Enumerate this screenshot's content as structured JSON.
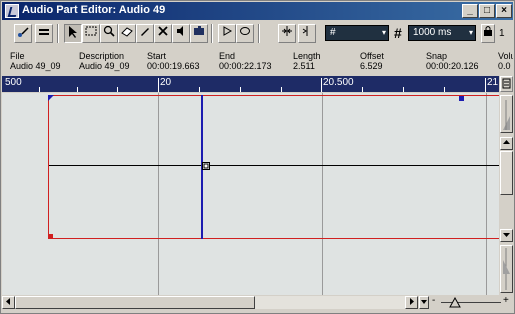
{
  "window": {
    "title": "Audio Part Editor: Audio 49",
    "minimize_glyph": "_",
    "maximize_glyph": "□",
    "close_glyph": "×"
  },
  "toolbar": {
    "quantize_value": "#",
    "grid_value": "1000 ms",
    "snap_count": "1",
    "arrow_glyph": "▾"
  },
  "info": {
    "fields": [
      {
        "label": "File",
        "value": "Audio 49_09"
      },
      {
        "label": "Description",
        "value": "Audio 49_09"
      },
      {
        "label": "Start",
        "value": "00:00:19.663"
      },
      {
        "label": "End",
        "value": "00:00:22.173"
      },
      {
        "label": "Length",
        "value": "2.511"
      },
      {
        "label": "Offset",
        "value": "6.529"
      },
      {
        "label": "Snap",
        "value": "00:00:20.126"
      },
      {
        "label": "Volu",
        "value": "0.0"
      }
    ]
  },
  "ruler": {
    "labels": [
      "500",
      "20",
      "20.500",
      "21"
    ]
  },
  "colors": {
    "ruler_bg": "#1e2b66",
    "part_border": "#d02020",
    "cursor": "#1c1cb0",
    "canvas_bg": "#dfe3e2"
  },
  "icons": [
    "app-icon",
    "show-info-icon",
    "autoscroll-icon",
    "arrow-tool-icon",
    "range-tool-icon",
    "zoom-tool-icon",
    "erase-tool-icon",
    "scissors-tool-icon",
    "mute-tool-icon",
    "speaker-tool-icon",
    "draw-tool-icon",
    "play-icon",
    "loop-icon",
    "snap-icon",
    "snap-zero-icon",
    "grid-icon",
    "lock-icon"
  ]
}
